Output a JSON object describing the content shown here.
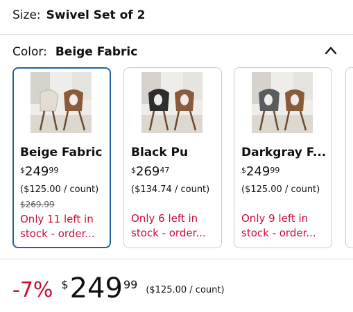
{
  "size": {
    "label": "Size:",
    "value": "Swivel Set of 2"
  },
  "color": {
    "label": "Color:",
    "value": "Beige Fabric",
    "collapse_icon": "chevron-up-icon"
  },
  "options": [
    {
      "name": "Beige Fabric",
      "currency": "$",
      "whole": "249",
      "fraction": "99",
      "unit_price": "($125.00 / count)",
      "list_price": "$269.99",
      "stock_line1": "Only 11 left in",
      "stock_line2": "stock - order...",
      "selected": true,
      "seat_color": "#e2ddd3"
    },
    {
      "name": "Black Pu",
      "currency": "$",
      "whole": "269",
      "fraction": "47",
      "unit_price": "($134.74 / count)",
      "list_price": "",
      "stock_line1": "Only 6 left in",
      "stock_line2": "stock - order...",
      "selected": false,
      "seat_color": "#2e2e2e"
    },
    {
      "name": "Darkgray F...",
      "currency": "$",
      "whole": "249",
      "fraction": "99",
      "unit_price": "($125.00 / count)",
      "list_price": "",
      "stock_line1": "Only 9 left in",
      "stock_line2": "stock - order...",
      "selected": false,
      "seat_color": "#5a5c5e"
    }
  ],
  "summary": {
    "discount": "-7%",
    "currency": "$",
    "whole": "249",
    "fraction": "99",
    "unit_price": "($125.00 / count)"
  },
  "colors": {
    "accent_border": "#2162a1",
    "stock_red": "#cc0c39",
    "divider": "#d5d9d9"
  }
}
